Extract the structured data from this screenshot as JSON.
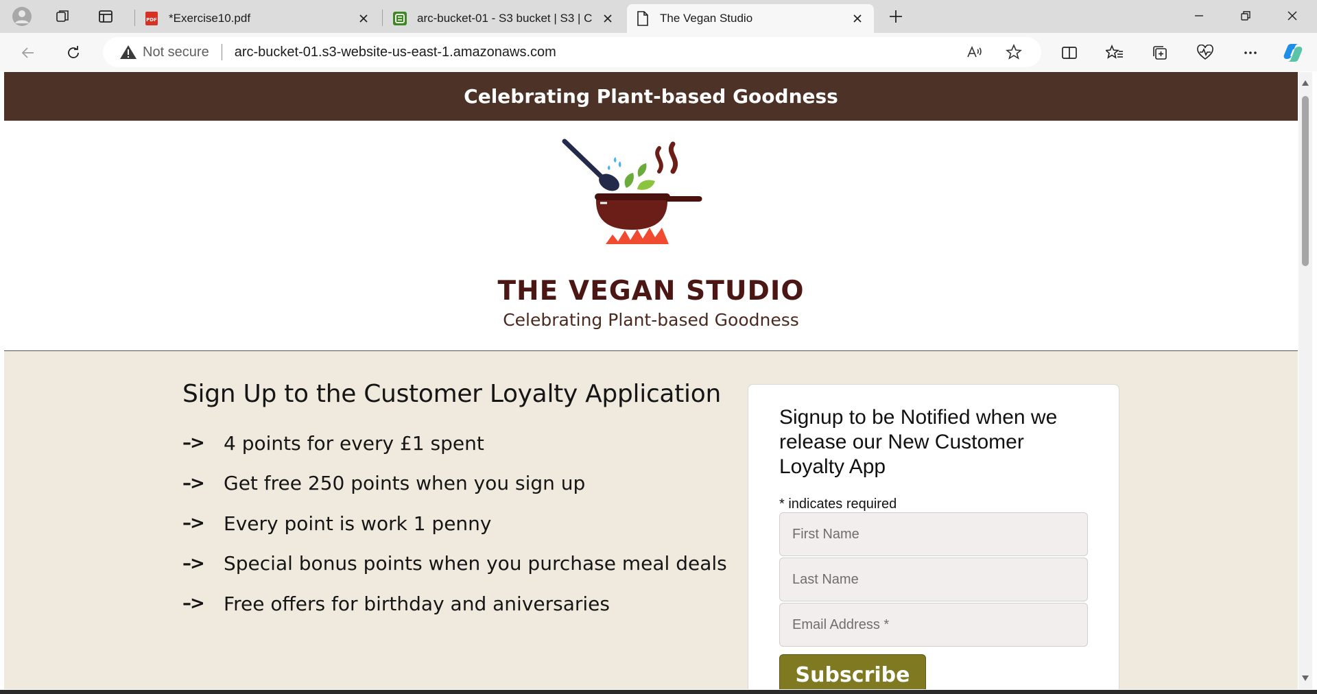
{
  "browser": {
    "tabs": [
      {
        "title": "*Exercise10.pdf",
        "icon": "pdf-icon",
        "active": false
      },
      {
        "title": "arc-bucket-01 - S3 bucket | S3 | C",
        "icon": "s3-bucket-icon",
        "active": false
      },
      {
        "title": "The Vegan Studio",
        "icon": "page-icon",
        "active": true
      }
    ],
    "security_label": "Not secure",
    "url": "arc-bucket-01.s3-website-us-east-1.amazonaws.com"
  },
  "page": {
    "banner": "Celebrating Plant-based Goodness",
    "brand_title": "THE VEGAN STUDIO",
    "brand_subtitle": "Celebrating Plant-based Goodness",
    "loyalty": {
      "heading": "Sign Up to the Customer Loyalty Application",
      "arrow": "–>",
      "benefits": [
        "4 points for every £1 spent",
        "Get free 250 points when you sign up",
        "Every point is work 1 penny",
        "Special bonus points when you purchase meal deals",
        "Free offers for birthday and aniversaries"
      ]
    },
    "signup": {
      "heading": "Signup to be Notified when we release our New Customer Loyalty App",
      "required_note": "* indicates required",
      "first_name_placeholder": "First Name",
      "last_name_placeholder": "Last Name",
      "email_placeholder": "Email Address *",
      "subscribe_label": "Subscribe"
    }
  },
  "colors": {
    "banner_bg": "#4d3327",
    "content_bg": "#efe9de",
    "subscribe_bg": "#7f7a21",
    "brand_text": "#4a1714"
  }
}
